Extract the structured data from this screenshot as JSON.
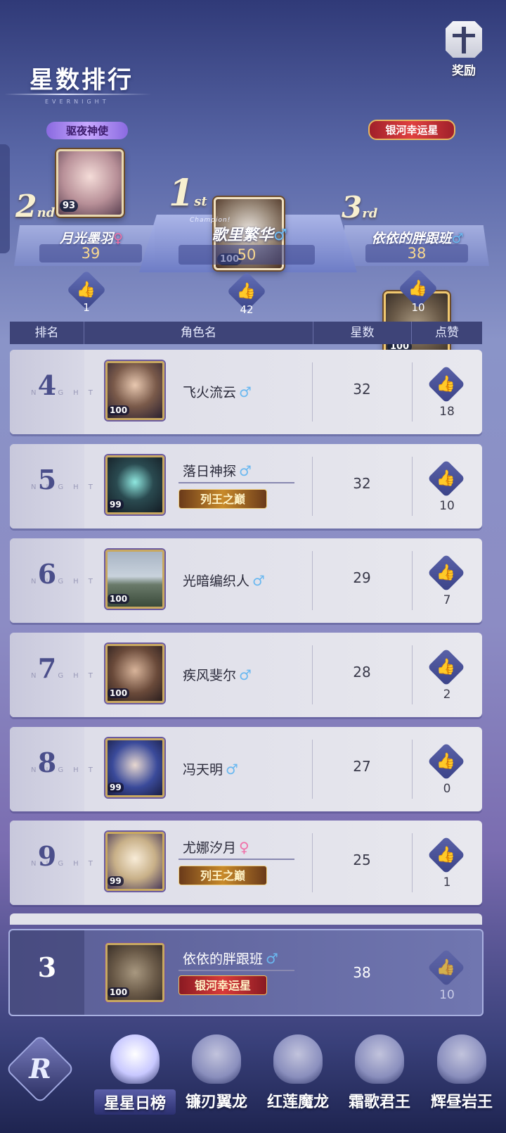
{
  "header": {
    "title": "星数排行",
    "subtitle": "EVERNIGHT",
    "reward_label": "奖励"
  },
  "podium": {
    "first": {
      "place": "1",
      "place_suffix": "st",
      "name": "歌里繁华",
      "gender": "♂",
      "score": "50",
      "level": "100",
      "likes": "42",
      "tag": "Champion!"
    },
    "second": {
      "place": "2",
      "place_suffix": "nd",
      "name": "月光墨羽",
      "gender": "♀",
      "score": "39",
      "level": "93",
      "likes": "1",
      "tag": "驱夜神使"
    },
    "third": {
      "place": "3",
      "place_suffix": "rd",
      "name": "依依的胖跟班",
      "gender": "♂",
      "score": "38",
      "level": "100",
      "likes": "10",
      "tag": "银河幸运星"
    }
  },
  "table_header": {
    "rank": "排名",
    "name": "角色名",
    "stars": "星数",
    "likes": "点赞"
  },
  "rows": [
    {
      "rank": "4",
      "name": "飞火流云",
      "gender": "♂",
      "stars": "32",
      "likes": "18",
      "level": "100",
      "badge": ""
    },
    {
      "rank": "5",
      "name": "落日神探",
      "gender": "♂",
      "stars": "32",
      "likes": "10",
      "level": "99",
      "badge": "列王之巅"
    },
    {
      "rank": "6",
      "name": "光暗编织人",
      "gender": "♂",
      "stars": "29",
      "likes": "7",
      "level": "100",
      "badge": ""
    },
    {
      "rank": "7",
      "name": "疾风斐尔",
      "gender": "♂",
      "stars": "28",
      "likes": "2",
      "level": "100",
      "badge": ""
    },
    {
      "rank": "8",
      "name": "冯天明",
      "gender": "♂",
      "stars": "27",
      "likes": "0",
      "level": "99",
      "badge": ""
    },
    {
      "rank": "9",
      "name": "尤娜汐月",
      "gender": "♀",
      "stars": "25",
      "likes": "1",
      "level": "99",
      "badge": "列王之巅"
    }
  ],
  "watermark": "NIGHT",
  "my_row": {
    "rank": "3",
    "name": "依依的胖跟班",
    "gender": "♂",
    "stars": "38",
    "likes": "10",
    "level": "100",
    "badge": "银河幸运星"
  },
  "nav": {
    "logo": "R",
    "tabs": [
      {
        "label": "星星日榜",
        "active": true
      },
      {
        "label": "镰刃翼龙",
        "active": false
      },
      {
        "label": "红莲魔龙",
        "active": false
      },
      {
        "label": "霜歌君王",
        "active": false
      },
      {
        "label": "辉昼岩王",
        "active": false
      }
    ]
  },
  "colors": {
    "accent": "#4a4e8a",
    "gold": "#f8d890",
    "male": "#6ab8f0",
    "female": "#f070a8"
  }
}
